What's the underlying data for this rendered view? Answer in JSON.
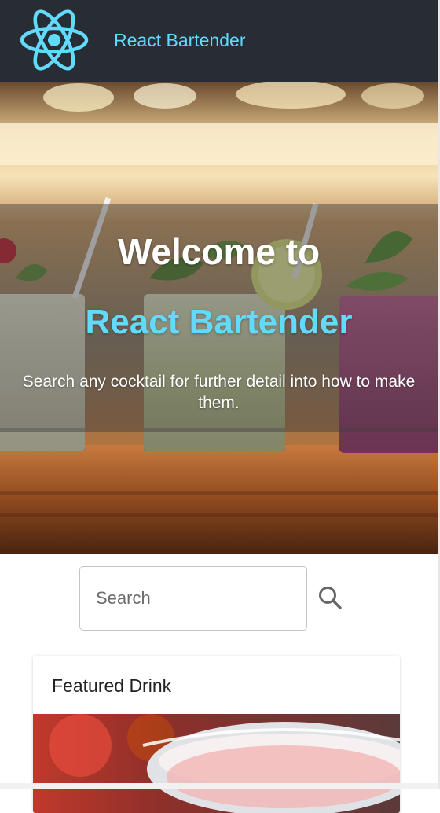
{
  "header": {
    "brand": "React Bartender",
    "logo_icon": "react-logo-icon",
    "background_color": "#282c34",
    "accent_color": "#61dafb"
  },
  "hero": {
    "title": "Welcome to",
    "brand": "React Bartender",
    "subtitle": "Search any cocktail for further detail into how to make them."
  },
  "search": {
    "placeholder": "Search",
    "value": "",
    "button_icon": "search-icon"
  },
  "featured": {
    "header": "Featured Drink"
  }
}
